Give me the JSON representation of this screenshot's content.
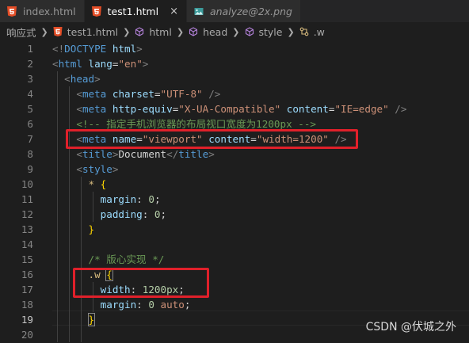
{
  "tabs": [
    {
      "label": "index.html",
      "icon": "html5-icon"
    },
    {
      "label": "test1.html",
      "icon": "html5-icon",
      "close": "×"
    },
    {
      "label": "analyze@2x.png",
      "icon": "image-icon"
    }
  ],
  "breadcrumb": {
    "folder": "响应式",
    "file": "test1.html",
    "html": "html",
    "head": "head",
    "style": "style",
    "selector": ".w"
  },
  "line_numbers": [
    "1",
    "2",
    "3",
    "4",
    "5",
    "6",
    "7",
    "8",
    "9",
    "10",
    "11",
    "12",
    "13",
    "14",
    "15",
    "16",
    "17",
    "18",
    "19",
    "20"
  ],
  "code": {
    "l1": {
      "open": "<!",
      "kw": "DOCTYPE",
      "html": " html",
      "close": ">"
    },
    "l2": {
      "open": "<",
      "tag": "html",
      "attr": " lang",
      "eq": "=",
      "val": "\"en\"",
      "close": ">"
    },
    "l3": {
      "open": "<",
      "tag": "head",
      "close": ">"
    },
    "l4": {
      "open": "<",
      "tag": "meta",
      "attr": " charset",
      "eq": "=",
      "val": "\"UTF-8\"",
      "close": " />"
    },
    "l5": {
      "open": "<",
      "tag": "meta",
      "attr1": " http-equiv",
      "eq1": "=",
      "val1": "\"X-UA-Compatible\"",
      "attr2": " content",
      "eq2": "=",
      "val2": "\"IE=edge\"",
      "close": " />"
    },
    "l6": {
      "comment": "<!-- 指定手机浏览器的布局视口宽度为1200px -->"
    },
    "l7": {
      "open": "<",
      "tag": "meta",
      "attr1": " name",
      "eq1": "=",
      "val1": "\"viewport\"",
      "attr2": " content",
      "eq2": "=",
      "val2": "\"width=1200\"",
      "close": " />"
    },
    "l8": {
      "open": "<",
      "tag": "title",
      "mid": ">",
      "text": "Document",
      "open2": "</",
      "tag2": "title",
      "close": ">"
    },
    "l9": {
      "open": "<",
      "tag": "style",
      "close": ">"
    },
    "l10": {
      "selector": "* ",
      "brace": "{"
    },
    "l11": {
      "prop": "margin",
      "colon": ": ",
      "num": "0",
      "semi": ";"
    },
    "l12": {
      "prop": "padding",
      "colon": ": ",
      "num": "0",
      "semi": ";"
    },
    "l13": {
      "brace": "}"
    },
    "l14": {
      "text": ""
    },
    "l15": {
      "comment": "/* 版心实现 */"
    },
    "l16": {
      "selector": ".w ",
      "brace": "{"
    },
    "l17": {
      "prop": "width",
      "colon": ": ",
      "num": "1200px",
      "semi": ";"
    },
    "l18": {
      "prop": "margin",
      "colon": ": ",
      "num": "0",
      "val": " auto",
      "semi": ";"
    },
    "l19": {
      "brace": "}"
    },
    "l20": {
      "text": ""
    }
  },
  "watermark": "CSDN @伏城之外",
  "colors": {
    "highlight_box": "#e0202a",
    "editor_bg": "#1e1e1e"
  }
}
